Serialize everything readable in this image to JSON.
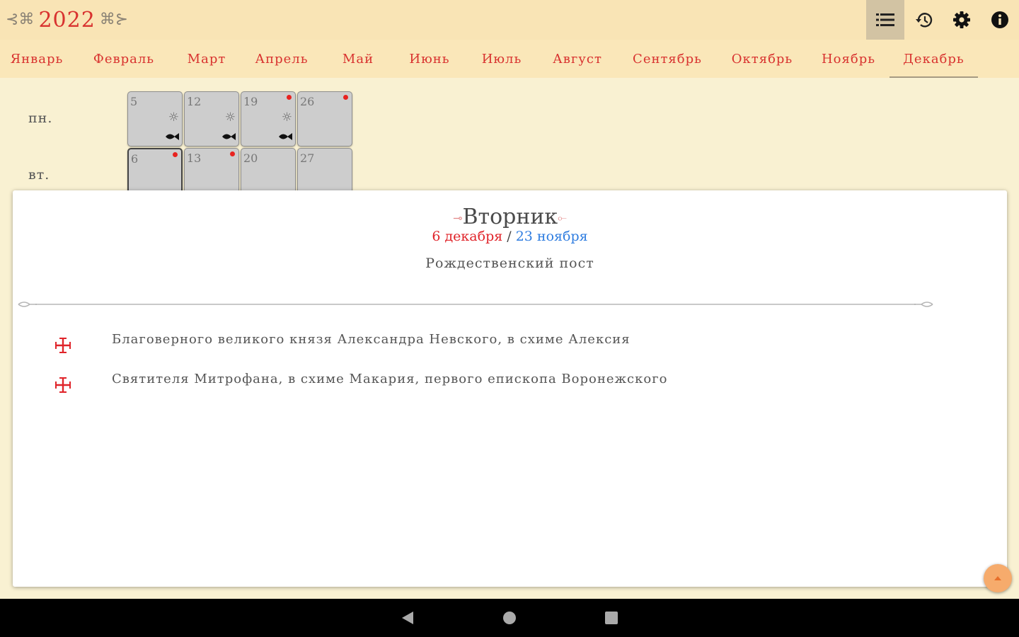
{
  "header": {
    "year": "2022",
    "icons": [
      "list-icon",
      "history-icon",
      "settings-icon",
      "info-icon"
    ]
  },
  "months": [
    {
      "label": "Январь",
      "selected": false
    },
    {
      "label": "Февраль",
      "selected": false
    },
    {
      "label": "Март",
      "selected": false
    },
    {
      "label": "Апрель",
      "selected": false
    },
    {
      "label": "Май",
      "selected": false
    },
    {
      "label": "Июнь",
      "selected": false
    },
    {
      "label": "Июль",
      "selected": false
    },
    {
      "label": "Август",
      "selected": false
    },
    {
      "label": "Сентябрь",
      "selected": false
    },
    {
      "label": "Октябрь",
      "selected": false
    },
    {
      "label": "Ноябрь",
      "selected": false
    },
    {
      "label": "Декабрь",
      "selected": true
    }
  ],
  "calendar": {
    "weekdays": [
      "пн.",
      "вт."
    ],
    "rows": [
      [
        {
          "day": "5",
          "dot": false,
          "sun": true,
          "fish": true
        },
        {
          "day": "12",
          "dot": false,
          "sun": true,
          "fish": true
        },
        {
          "day": "19",
          "dot": true,
          "sun": true,
          "fish": true
        },
        {
          "day": "26",
          "dot": true,
          "sun": false,
          "fish": false
        }
      ],
      [
        {
          "day": "6",
          "dot": true,
          "sun": false,
          "fish": false
        },
        {
          "day": "13",
          "dot": true,
          "sun": false,
          "fish": false
        },
        {
          "day": "20",
          "dot": false,
          "sun": false,
          "fish": false
        },
        {
          "day": "27",
          "dot": false,
          "sun": false,
          "fish": false
        }
      ]
    ]
  },
  "detail": {
    "weekday": "Вторник",
    "date_new": "6 декабря",
    "date_sep": " / ",
    "date_old": "23 ноября",
    "fast": "Рождественский пост",
    "entries": [
      "Благоверного великого князя Александра Невского, в схиме Алексия",
      "Святителя Митрофана, в схиме Макария, первого епископа Воронежского"
    ]
  },
  "colors": {
    "accent_red": "#d8322f",
    "old_style_blue": "#2f7de0",
    "background": "#f9f1d2",
    "header": "#f9e4b5"
  }
}
